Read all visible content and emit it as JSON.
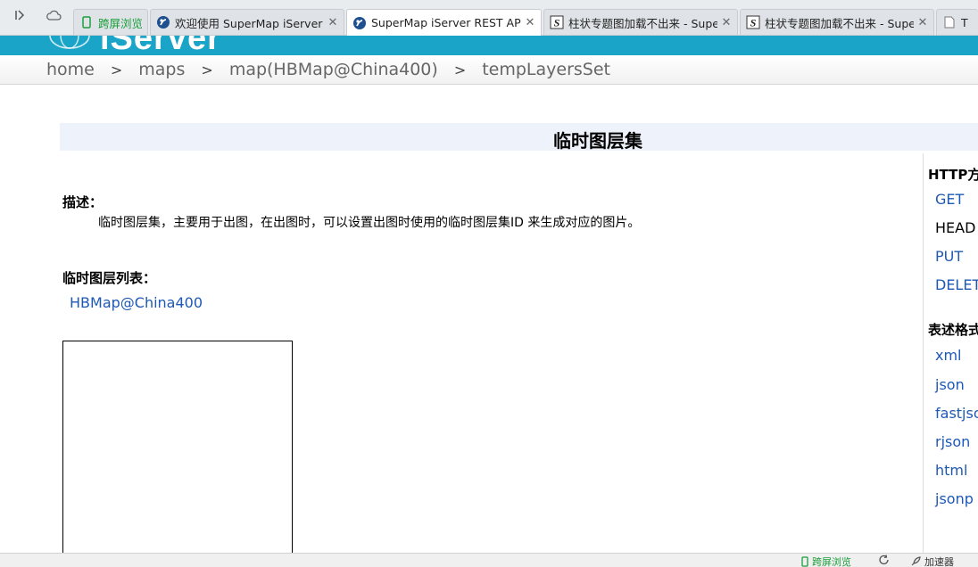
{
  "browser": {
    "tabs": [
      {
        "title": "跨屏浏览",
        "type": "split"
      },
      {
        "title": "欢迎使用 SuperMap iServer",
        "type": "supermap"
      },
      {
        "title": "SuperMap iServer REST API",
        "type": "supermap",
        "active": true
      },
      {
        "title": "柱状专题图加载不出来 - SuperMap",
        "type": "s"
      },
      {
        "title": "柱状专题图加载不出来 - SuperMap",
        "type": "s"
      },
      {
        "title": "T",
        "type": "doc"
      }
    ],
    "close_glyph": "✕"
  },
  "banner": {
    "logo_text": "iServer"
  },
  "breadcrumb": {
    "items": [
      "home",
      "maps",
      "map(HBMap@China400)",
      "tempLayersSet"
    ],
    "separator": ">"
  },
  "page": {
    "title": "临时图层集",
    "description_label": "描述：",
    "description_text": "临时图层集，主要用于出图，在出图时，可以设置出图时使用的临时图层集ID 来生成对应的图片。",
    "list_label": "临时图层列表：",
    "layers": [
      "HBMap@China400"
    ]
  },
  "sidebar": {
    "http_heading": "HTTP方法",
    "methods": [
      {
        "label": "GET",
        "link": true
      },
      {
        "label": "HEAD",
        "link": false
      },
      {
        "label": "PUT",
        "link": true
      },
      {
        "label": "DELETE",
        "link": true
      }
    ],
    "format_heading": "表述格式",
    "formats": [
      "xml",
      "json",
      "fastjson",
      "rjson",
      "html",
      "jsonp"
    ]
  },
  "statusbar": {
    "split_label": "跨屏浏览",
    "accelerator_label": "加速器"
  },
  "colors": {
    "banner": "#1aa4c8",
    "link": "#1e59b5",
    "title_strip": "#eef3fb"
  }
}
